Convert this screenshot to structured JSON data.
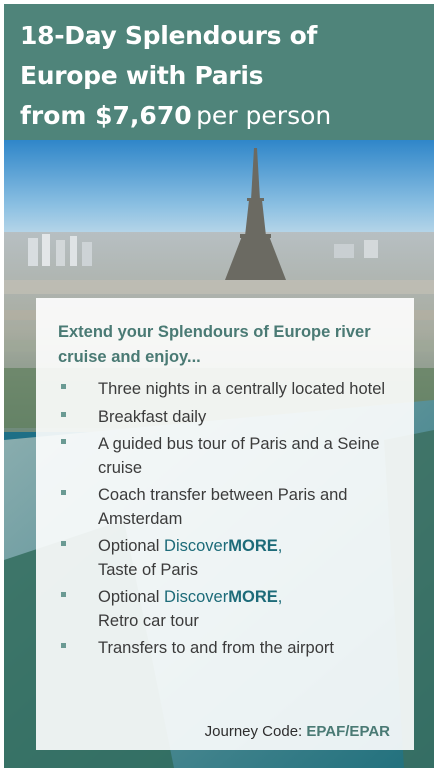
{
  "header": {
    "title_line1": "18-Day Splendours of",
    "title_line2": "Europe with Paris",
    "price": "from $7,670",
    "price_suffix": "per person"
  },
  "card": {
    "intro": "Extend your Splendours of Europe river cruise and enjoy...",
    "items": [
      "Three nights in a centrally located hotel",
      "Breakfast daily",
      "A guided bus tour of Paris and a Seine cruise",
      "Coach transfer between Paris and Amsterdam",
      {
        "prefix": "Optional ",
        "brand": "Discover",
        "brand_bold": "MORE",
        "after": ",",
        "line2": "Taste of Paris"
      },
      {
        "prefix": "Optional ",
        "brand": "Discover",
        "brand_bold": "MORE",
        "after": ",",
        "line2": "Retro car tour"
      },
      "Transfers to and from the airport"
    ],
    "journey_code_label": "Journey Code:",
    "journey_code_value": "EPAF/EPAR"
  },
  "colors": {
    "header_bg": "#4f847a",
    "accent_text": "#4a7a74",
    "brand_text": "#1d6b79",
    "bullet": "#6a9a93"
  }
}
